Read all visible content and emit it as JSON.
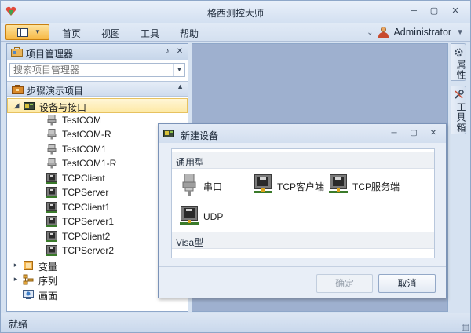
{
  "window": {
    "title": "格西测控大师",
    "controls": [
      "minimize",
      "maximize",
      "close"
    ]
  },
  "menubar": {
    "items": [
      {
        "label": "首页"
      },
      {
        "label": "视图"
      },
      {
        "label": "工具"
      },
      {
        "label": "帮助"
      }
    ],
    "user": "Administrator"
  },
  "left_panel": {
    "title": "项目管理器",
    "search_placeholder": "搜索项目管理器",
    "project_name": "步骤演示项目",
    "tree": {
      "device_group": "设备与接口",
      "devices": [
        "TestCOM",
        "TestCOM-R",
        "TestCOM1",
        "TestCOM1-R",
        "TCPClient",
        "TCPServer",
        "TCPClient1",
        "TCPServer1",
        "TCPClient2",
        "TCPServer2"
      ],
      "variables": "变量",
      "sequences": "序列",
      "screens": "画面"
    }
  },
  "side_tabs": [
    "属性",
    "工具箱"
  ],
  "dialog": {
    "title": "新建设备",
    "groups": [
      {
        "label": "通用型",
        "items": [
          "串口",
          "TCP客户端",
          "TCP服务端",
          "UDP"
        ]
      },
      {
        "label": "Visa型",
        "items": []
      }
    ],
    "ok_label": "确定",
    "cancel_label": "取消"
  },
  "status": {
    "text": "就绪"
  },
  "colors": {
    "accent": "#f7b844",
    "workspace": "#9eb0cf",
    "selection": "#fde9a5"
  }
}
